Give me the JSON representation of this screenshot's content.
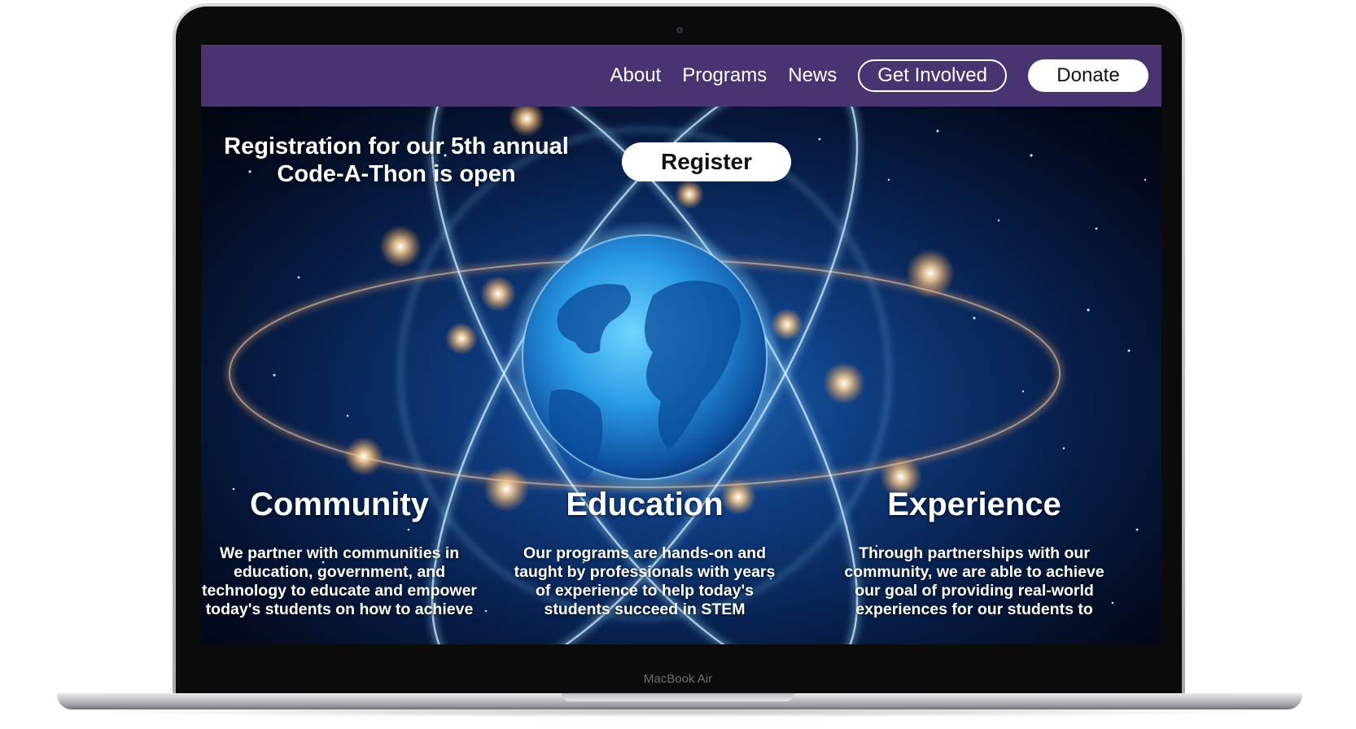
{
  "device": {
    "label": "MacBook Air"
  },
  "navbar": {
    "links": [
      "About",
      "Programs",
      "News"
    ],
    "get_involved_label": "Get Involved",
    "donate_label": "Donate",
    "background_color": "#473470"
  },
  "hero": {
    "announcement_line1": "Registration for our 5th annual",
    "announcement_line2": "Code-A-Thon is open",
    "register_label": "Register",
    "background_image": "globe-with-atom-orbits"
  },
  "features": [
    {
      "title": "Community",
      "lines": [
        "We partner with communities in",
        "education, government, and",
        "technology to educate and empower",
        "today's students on how to achieve"
      ]
    },
    {
      "title": "Education",
      "lines": [
        "Our programs are hands-on and",
        "taught by professionals with years",
        "of experience to help today's",
        "students succeed in STEM"
      ]
    },
    {
      "title": "Experience",
      "lines": [
        "Through partnerships with our",
        "community, we are able to achieve",
        "our goal of providing real-world",
        "experiences for our students to"
      ]
    }
  ]
}
